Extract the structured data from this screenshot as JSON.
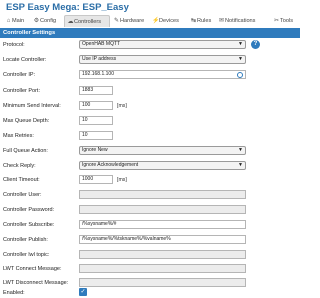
{
  "app": {
    "title": "ESP Easy Mega: ESP_Easy"
  },
  "menu": {
    "tabs": [
      {
        "label": "Main",
        "icon": "home-icon"
      },
      {
        "label": "Config",
        "icon": "wrench-icon"
      },
      {
        "label": "Controllers",
        "icon": "cloud-icon"
      },
      {
        "label": "Hardware",
        "icon": "pin-icon"
      },
      {
        "label": "Devices",
        "icon": "plug-icon"
      },
      {
        "label": "Rules",
        "icon": "arrows-icon"
      },
      {
        "label": "Notifications",
        "icon": "mail-icon"
      },
      {
        "label": "Tools",
        "icon": "tools-icon"
      }
    ],
    "active": "Controllers"
  },
  "section": {
    "header": "Controller Settings"
  },
  "form": {
    "protocol": {
      "label": "Protocol:",
      "value": "OpenHAB MQTT",
      "help": "?"
    },
    "locate": {
      "label": "Locate Controller:",
      "value": "Use IP address"
    },
    "ip": {
      "label": "Controller IP:",
      "value": "192.168.1.100"
    },
    "port": {
      "label": "Controller Port:",
      "value": "1883"
    },
    "min_send": {
      "label": "Minimum Send Interval:",
      "value": "100",
      "unit": "[ms]"
    },
    "queue_depth": {
      "label": "Max Queue Depth:",
      "value": "10"
    },
    "retries": {
      "label": "Max Retries:",
      "value": "10"
    },
    "full_queue": {
      "label": "Full Queue Action:",
      "value": "Ignore New"
    },
    "check_reply": {
      "label": "Check Reply:",
      "value": "Ignore Acknowledgement"
    },
    "timeout": {
      "label": "Client Timeout:",
      "value": "1000",
      "unit": "[ms]"
    },
    "user": {
      "label": "Controller User:",
      "value": ""
    },
    "password": {
      "label": "Controller Password:",
      "value": ""
    },
    "subscribe": {
      "label": "Controller Subscribe:",
      "value": "/%sysname%/#"
    },
    "publish": {
      "label": "Controller Publish:",
      "value": "/%sysname%/%tskname%/%valname%"
    },
    "lwt_topic": {
      "label": "Controller lwl topic:",
      "value": ""
    },
    "lwt_connect": {
      "label": "LWT Connect Message:",
      "value": ""
    },
    "lwt_disconnect": {
      "label": "LWT Disconnect Message:",
      "value": ""
    },
    "enabled": {
      "label": "Enabled:",
      "checked": true
    }
  },
  "colors": {
    "accent": "#2f7bbd",
    "title": "#2b6ea7"
  }
}
